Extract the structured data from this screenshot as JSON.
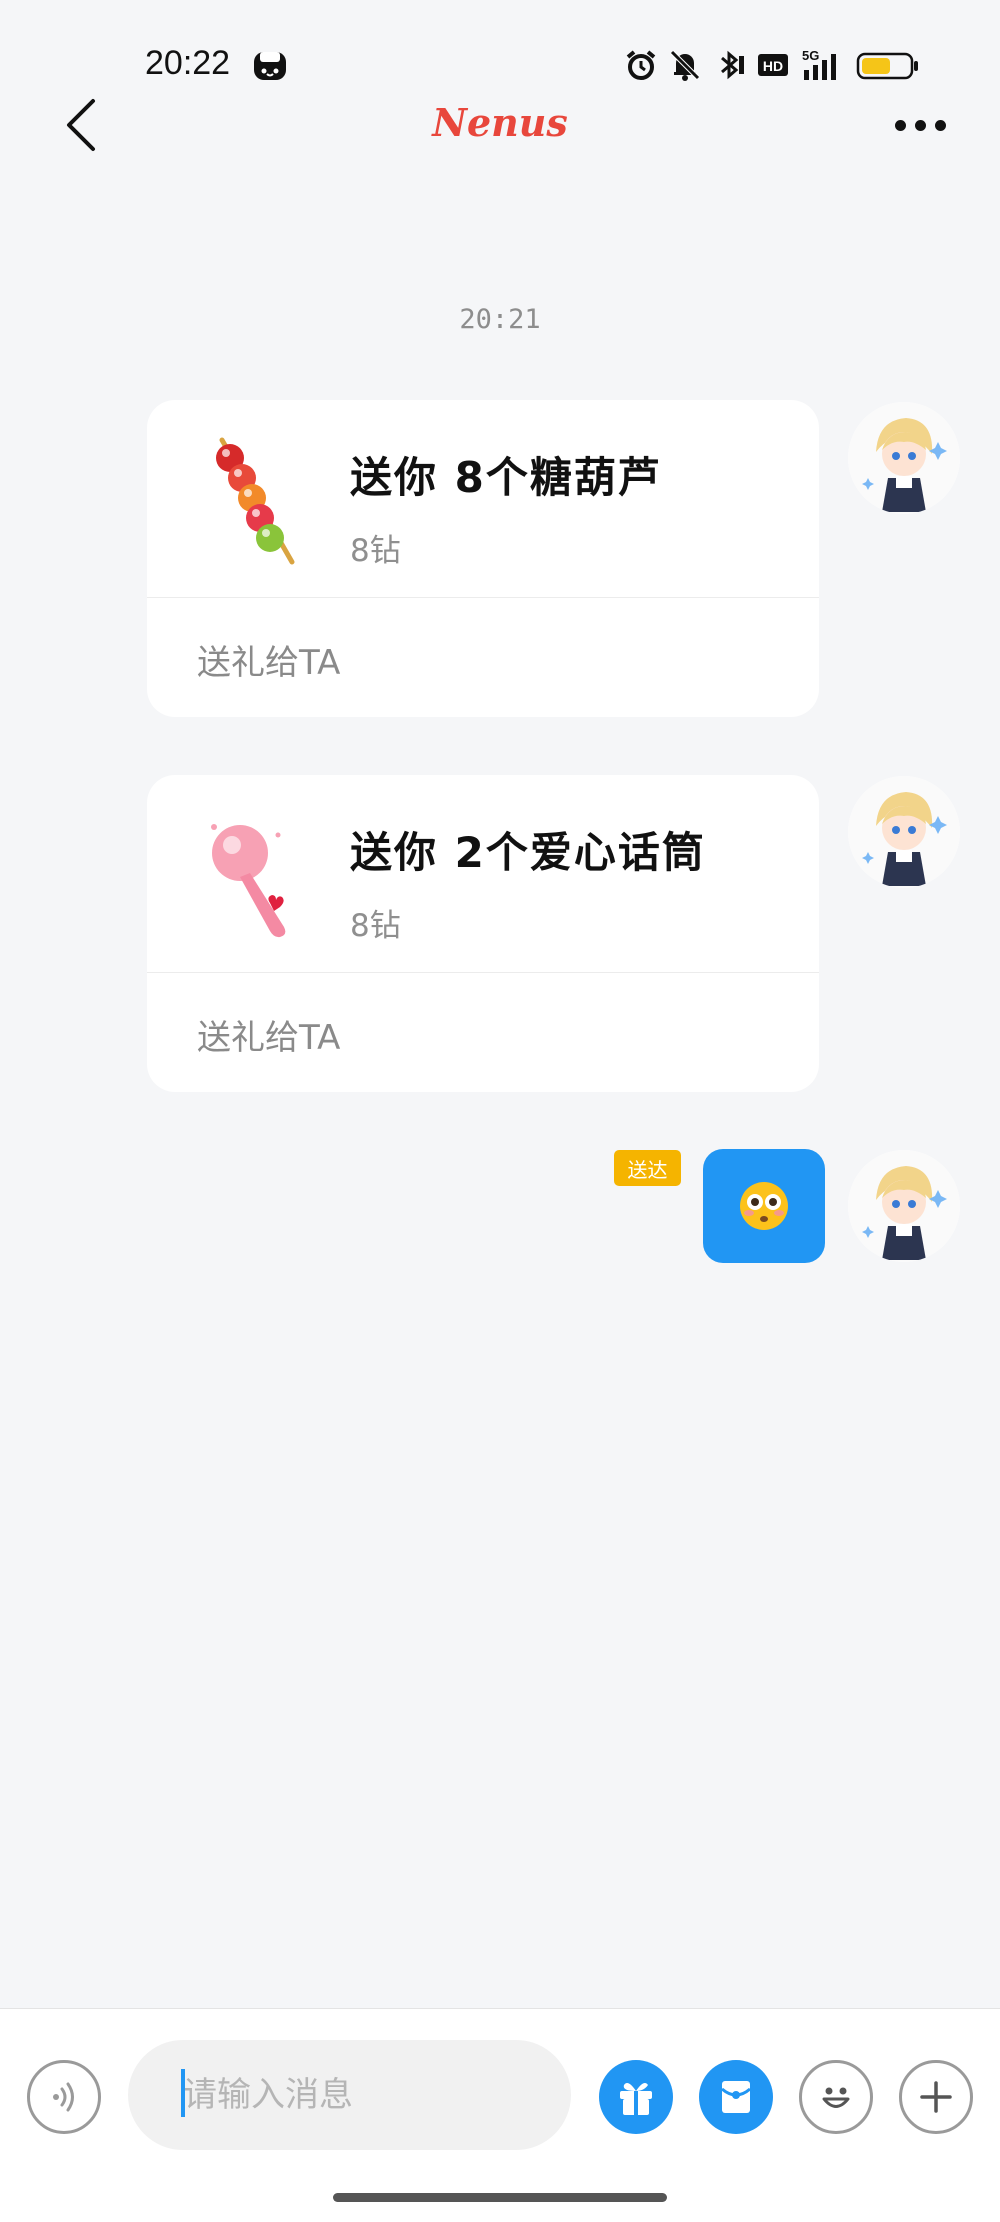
{
  "status_bar": {
    "time": "20:22",
    "network": "5G",
    "hd_label": "HD",
    "icons": [
      "alarm-icon",
      "mute-icon",
      "bluetooth-icon",
      "hd-icon",
      "signal-5g-icon",
      "battery-icon"
    ]
  },
  "header": {
    "title": "Nenus"
  },
  "chat": {
    "timestamp": "20:21",
    "gifts": [
      {
        "title": "送你 8个糖葫芦",
        "price": "8钻",
        "action": "送礼给TA",
        "icon": "candied-haws-icon"
      },
      {
        "title": "送你 2个爱心话筒",
        "price": "8钻",
        "action": "送礼给TA",
        "icon": "heart-microphone-icon"
      }
    ],
    "emoji_message": {
      "content": "😳",
      "status": "送达"
    }
  },
  "composer": {
    "placeholder": "请输入消息",
    "buttons": [
      "voice-icon",
      "gift-icon",
      "red-packet-icon",
      "emoji-icon",
      "plus-icon"
    ]
  },
  "colors": {
    "accent_blue": "#2196f3",
    "title_red": "#e8473c",
    "badge_yellow": "#f5b400",
    "background": "#f5f6f8"
  }
}
